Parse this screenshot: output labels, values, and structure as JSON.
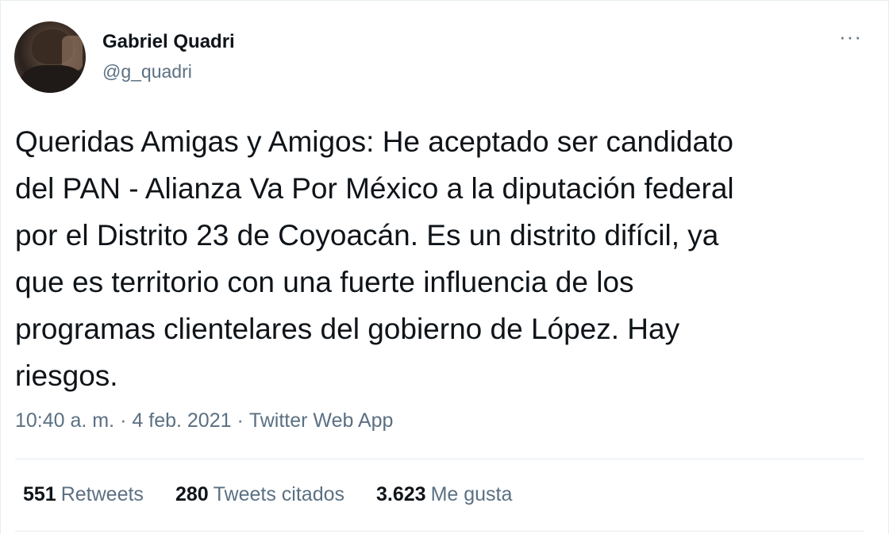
{
  "author": {
    "name": "Gabriel Quadri",
    "handle": "@g_quadri",
    "avatar_icon": "profile-photo"
  },
  "more_icon": "ellipsis-icon",
  "more_glyph": "···",
  "tweet": {
    "text": "Queridas Amigas y Amigos: He aceptado ser candidato del PAN - Alianza Va Por México a la diputación federal por el Distrito 23 de Coyoacán. Es un distrito difícil, ya que es territorio con una fuerte influencia de los programas clientelares del gobierno de López. Hay riesgos.",
    "lines": [
      "Queridas Amigas y Amigos: He aceptado ser candidato",
      "del PAN - Alianza Va Por México a la diputación federal",
      "por el Distrito 23 de Coyoacán. Es un distrito difícil, ya",
      "que es territorio con una fuerte influencia de los",
      "programas clientelares del gobierno de López. Hay",
      "riesgos."
    ]
  },
  "meta": {
    "time": "10:40 a. m.",
    "separator": "·",
    "date": "4 feb. 2021",
    "source": "Twitter Web App"
  },
  "stats": {
    "retweets_count": "551",
    "retweets_label": "Retweets",
    "quotes_count": "280",
    "quotes_label": "Tweets citados",
    "likes_count": "3.623",
    "likes_label": "Me gusta"
  },
  "colors": {
    "text": "#0f1419",
    "secondary": "#5b7083",
    "divider": "#e6ecf0"
  }
}
